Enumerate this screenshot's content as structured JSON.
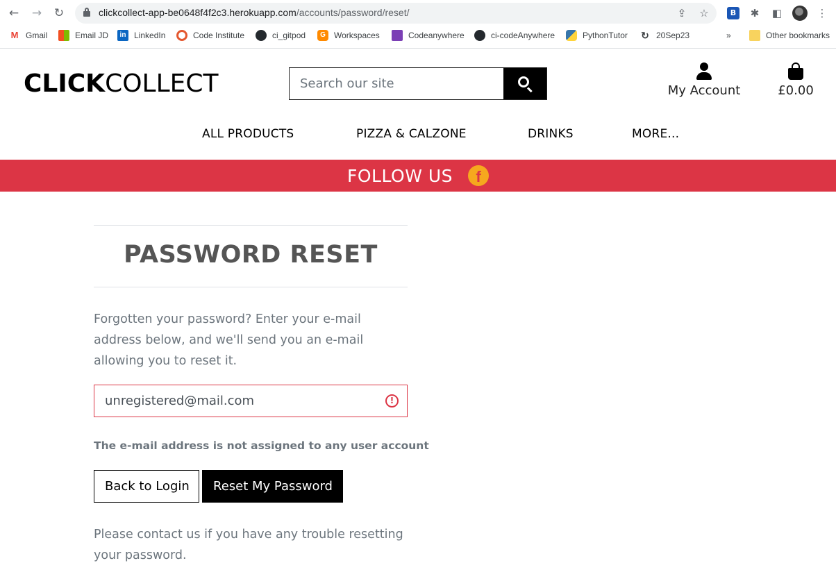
{
  "browser": {
    "url_host": "clickcollect-app-be0648f4f2c3.herokuapp.com",
    "url_path": "/accounts/password/reset/",
    "bookmarks": [
      {
        "label": "Gmail",
        "icon": "gmail-icon"
      },
      {
        "label": "Email JD",
        "icon": "microsoft-icon"
      },
      {
        "label": "LinkedIn",
        "icon": "linkedin-icon"
      },
      {
        "label": "Code Institute",
        "icon": "code-institute-icon"
      },
      {
        "label": "ci_gitpod",
        "icon": "github-icon"
      },
      {
        "label": "Workspaces",
        "icon": "gitpod-icon"
      },
      {
        "label": "Codeanywhere",
        "icon": "codeanywhere-icon"
      },
      {
        "label": "ci-codeAnywhere",
        "icon": "github-icon"
      },
      {
        "label": "PythonTutor",
        "icon": "python-icon"
      },
      {
        "label": "20Sep23",
        "icon": "loop-icon"
      }
    ],
    "overflow_label": "»",
    "other_bookmarks": "Other bookmarks"
  },
  "site": {
    "logo_bold": "CLICK",
    "logo_light": "COLLECT",
    "search_placeholder": "Search our site",
    "account_label": "My Account",
    "basket_total": "£0.00",
    "nav": [
      "ALL PRODUCTS",
      "PIZZA & CALZONE",
      "DRINKS",
      "MORE..."
    ],
    "banner_text": "FOLLOW US",
    "accent_color": "#dc3545"
  },
  "page": {
    "title": "PASSWORD RESET",
    "intro": "Forgotten your password? Enter your e-mail address below, and we'll send you an e-mail allowing you to reset it.",
    "email_value": "unregistered@mail.com",
    "error_message": "The e-mail address is not assigned to any user account",
    "back_button": "Back to Login",
    "reset_button": "Reset My Password",
    "help_text": "Please contact us if you have any trouble resetting your password."
  }
}
